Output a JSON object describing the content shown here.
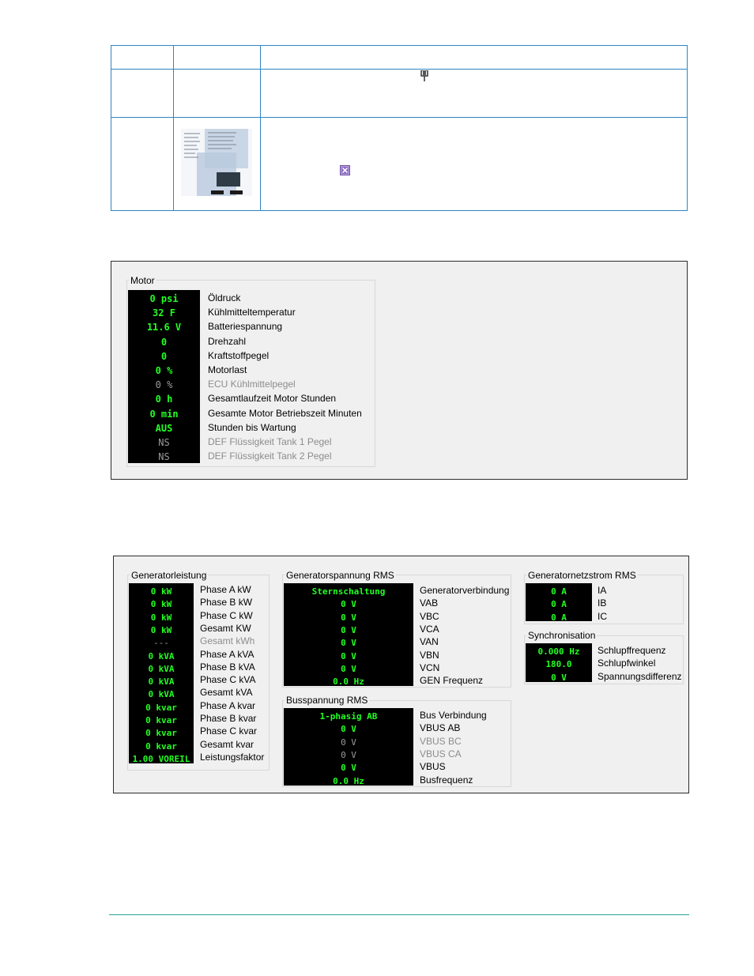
{
  "motor": {
    "title": "Motor",
    "rows": [
      {
        "value": "0 psi",
        "label": "Öldruck",
        "dim": false
      },
      {
        "value": "32 F",
        "label": "Kühlmitteltemperatur",
        "dim": false
      },
      {
        "value": "11.6 V",
        "label": "Batteriespannung",
        "dim": false
      },
      {
        "value": "0",
        "label": "Drehzahl",
        "dim": false
      },
      {
        "value": "0",
        "label": "Kraftstoffpegel",
        "dim": false
      },
      {
        "value": "0 %",
        "label": "Motorlast",
        "dim": false
      },
      {
        "value": "0 %",
        "label": "ECU Kühlmittelpegel",
        "dim": true
      },
      {
        "value": "0 h",
        "label": "Gesamtlaufzeit Motor Stunden",
        "dim": false
      },
      {
        "value": "0 min",
        "label": "Gesamte Motor Betriebszeit Minuten",
        "dim": false
      },
      {
        "value": "AUS",
        "label": "Stunden bis Wartung",
        "dim": false
      },
      {
        "value": "NS",
        "label": "DEF Flüssigkeit Tank 1 Pegel",
        "dim": true
      },
      {
        "value": "NS",
        "label": "DEF Flüssigkeit Tank 2 Pegel",
        "dim": true
      }
    ]
  },
  "generatorleistung": {
    "title": "Generatorleistung",
    "rows": [
      {
        "value": "0 kW",
        "label": "Phase A kW",
        "dim": false
      },
      {
        "value": "0 kW",
        "label": "Phase B kW",
        "dim": false
      },
      {
        "value": "0 kW",
        "label": "Phase C kW",
        "dim": false
      },
      {
        "value": "0 kW",
        "label": "Gesamt KW",
        "dim": false
      },
      {
        "value": "---",
        "label": "Gesamt kWh",
        "dim": true
      },
      {
        "value": "0 kVA",
        "label": "Phase A kVA",
        "dim": false
      },
      {
        "value": "0 kVA",
        "label": "Phase B kVA",
        "dim": false
      },
      {
        "value": "0 kVA",
        "label": "Phase C kVA",
        "dim": false
      },
      {
        "value": "0 kVA",
        "label": "Gesamt kVA",
        "dim": false
      },
      {
        "value": "0 kvar",
        "label": "Phase A kvar",
        "dim": false
      },
      {
        "value": "0 kvar",
        "label": "Phase B kvar",
        "dim": false
      },
      {
        "value": "0 kvar",
        "label": "Phase C kvar",
        "dim": false
      },
      {
        "value": "0 kvar",
        "label": "Gesamt kvar",
        "dim": false
      },
      {
        "value": "1.00 VOREIL",
        "label": "Leistungsfaktor",
        "dim": false
      }
    ]
  },
  "generatorspannung": {
    "title": "Generatorspannung RMS",
    "rows": [
      {
        "value": "Sternschaltung",
        "label": "Generatorverbindung",
        "dim": false
      },
      {
        "value": "0 V",
        "label": "VAB",
        "dim": false
      },
      {
        "value": "0 V",
        "label": "VBC",
        "dim": false
      },
      {
        "value": "0 V",
        "label": "VCA",
        "dim": false
      },
      {
        "value": "0 V",
        "label": "VAN",
        "dim": false
      },
      {
        "value": "0 V",
        "label": "VBN",
        "dim": false
      },
      {
        "value": "0 V",
        "label": "VCN",
        "dim": false
      },
      {
        "value": "0.0 Hz",
        "label": "GEN Frequenz",
        "dim": false
      }
    ]
  },
  "busspannung": {
    "title": "Busspannung RMS",
    "rows": [
      {
        "value": "1-phasig AB",
        "label": "Bus Verbindung",
        "dim": false
      },
      {
        "value": "0 V",
        "label": "VBUS AB",
        "dim": false
      },
      {
        "value": "0 V",
        "label": "VBUS BC",
        "dim": true
      },
      {
        "value": "0 V",
        "label": "VBUS CA",
        "dim": true
      },
      {
        "value": "0 V",
        "label": "VBUS",
        "dim": false
      },
      {
        "value": "0.0 Hz",
        "label": "Busfrequenz",
        "dim": false
      }
    ]
  },
  "generatornetzstrom": {
    "title": "Generatornetzstrom RMS",
    "rows": [
      {
        "value": "0 A",
        "label": "IA",
        "dim": false
      },
      {
        "value": "0 A",
        "label": "IB",
        "dim": false
      },
      {
        "value": "0 A",
        "label": "IC",
        "dim": false
      }
    ]
  },
  "synchronisation": {
    "title": "Synchronisation",
    "rows": [
      {
        "value": "0.000 Hz",
        "label": "Schlupffrequenz",
        "dim": false
      },
      {
        "value": "180.0",
        "label": "Schlupfwinkel",
        "dim": false
      },
      {
        "value": "0 V",
        "label": "Spannungsdifferenz",
        "dim": false
      }
    ]
  },
  "colors": {
    "lcd_green": "#22ff22",
    "lcd_bg": "#000000",
    "rule": "#2e86c1"
  },
  "icons": [
    "pin-icon",
    "close-icon"
  ]
}
